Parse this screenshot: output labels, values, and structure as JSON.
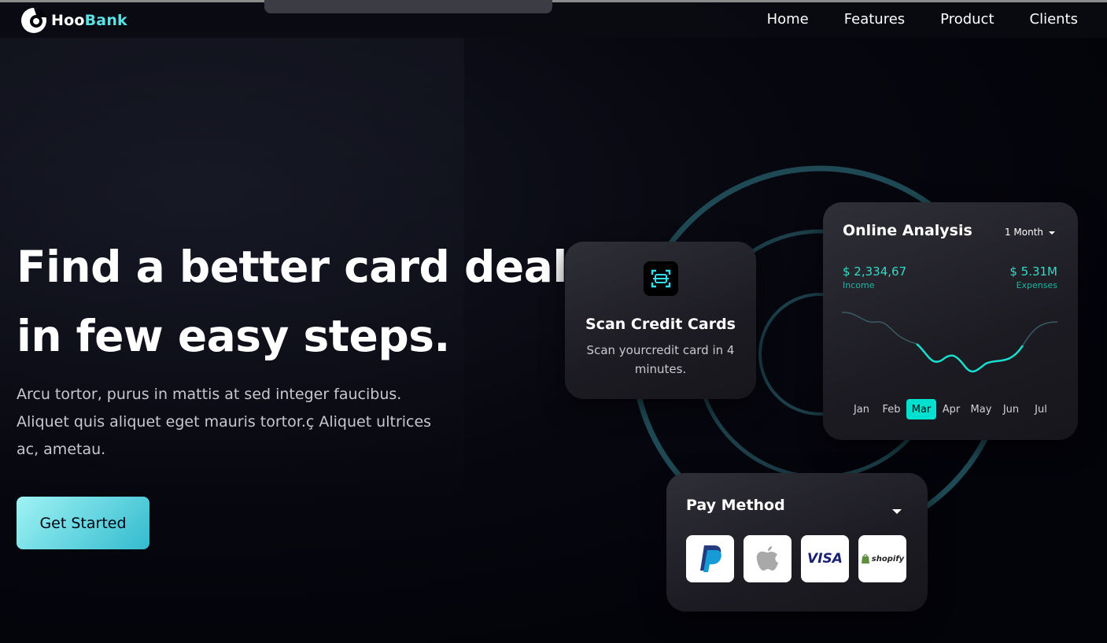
{
  "brand": {
    "name_part1": "Hoo",
    "name_part2": "Bank",
    "logo_icon": "hoobank-logo-icon"
  },
  "nav": {
    "items": [
      {
        "label": "Home"
      },
      {
        "label": "Features"
      },
      {
        "label": "Product"
      },
      {
        "label": "Clients"
      }
    ]
  },
  "hero": {
    "title_line1": "Find a better card deal",
    "title_line2": "in few easy steps.",
    "subtitle": "Arcu tortor, purus in mattis at sed integer faucibus. Aliquet quis aliquet eget mauris tortor.ç Aliquet ultrices ac, ametau.",
    "cta_label": "Get Started"
  },
  "scan_card": {
    "icon": "scan-icon",
    "title": "Scan Credit Cards",
    "description": "Scan yourcredit card in 4 minutes."
  },
  "analysis_card": {
    "title": "Online Analysis",
    "period": "1 Month",
    "income_value": "$ 2,334,67",
    "income_label": "Income",
    "expenses_value": "$ 5.31M",
    "expenses_label": "Expenses",
    "months": [
      "Jan",
      "Feb",
      "Mar",
      "Apr",
      "May",
      "Jun",
      "Jul"
    ],
    "active_month": "Mar"
  },
  "pay_card": {
    "title": "Pay Method",
    "methods": [
      "paypal-icon",
      "apple-icon",
      "VISA",
      "shopify"
    ]
  },
  "colors": {
    "accent": "#5ce1e6",
    "teal": "#00e1d0",
    "background": "#03030a"
  }
}
